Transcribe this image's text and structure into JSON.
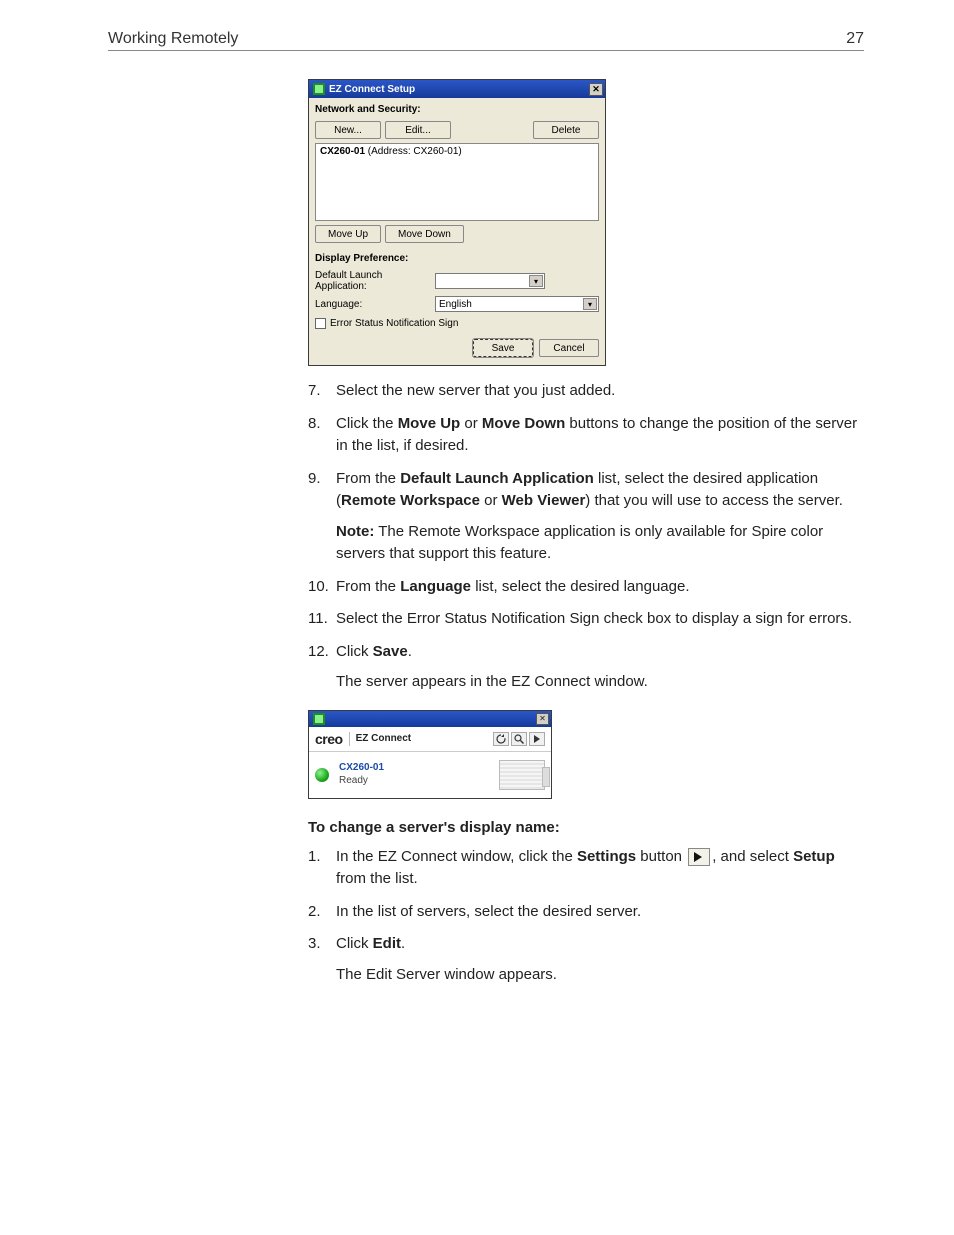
{
  "page": {
    "header_title": "Working Remotely",
    "page_number": "27"
  },
  "dialog": {
    "title": "EZ Connect Setup",
    "section_net": "Network and Security:",
    "btn_new": "New...",
    "btn_edit": "Edit...",
    "btn_delete": "Delete",
    "list_entry_name": "CX260-01",
    "list_entry_addr": " (Address: CX260-01)",
    "btn_moveup": "Move Up",
    "btn_movedown": "Move Down",
    "section_disp": "Display Preference:",
    "lbl_default_app": "Default Launch Application:",
    "default_app_value": "",
    "lbl_language": "Language:",
    "language_value": "English",
    "chk_label": "Error Status Notification Sign",
    "btn_save": "Save",
    "btn_cancel": "Cancel"
  },
  "steps1": [
    {
      "n": "7.",
      "html": "Select the new server that you just added."
    },
    {
      "n": "8.",
      "html": "Click the <b>Move Up</b> or <b>Move Down</b> buttons to change the position of the server in the list, if desired."
    },
    {
      "n": "9.",
      "html": "From the <b>Default Launch Application</b> list, select the desired application (<b>Remote Workspace</b> or <b>Web Viewer</b>) that you will use to access the server.",
      "note": "<b>Note:</b>  The Remote Workspace application is only available for Spire color servers that support this feature."
    },
    {
      "n": "10.",
      "html": "From the <b>Language</b> list, select the desired language."
    },
    {
      "n": "11.",
      "html": "Select the Error Status Notification Sign check box to display a sign for errors."
    },
    {
      "n": "12.",
      "html": "Click <b>Save</b>.",
      "sub": "The server appears in the EZ Connect window."
    }
  ],
  "ezc": {
    "logo": "creo",
    "title": "EZ Connect",
    "server_name": "CX260-01",
    "server_status": "Ready"
  },
  "section2_title": "To change a server's display name:",
  "steps2": [
    {
      "n": "1.",
      "html_pre": "In the EZ Connect window, click the <b>Settings</b> button ",
      "html_post": ", and select <b>Setup</b> from the list."
    },
    {
      "n": "2.",
      "html": "In the list of servers, select the desired server."
    },
    {
      "n": "3.",
      "html": "Click <b>Edit</b>.",
      "sub": "The Edit Server window appears."
    }
  ]
}
